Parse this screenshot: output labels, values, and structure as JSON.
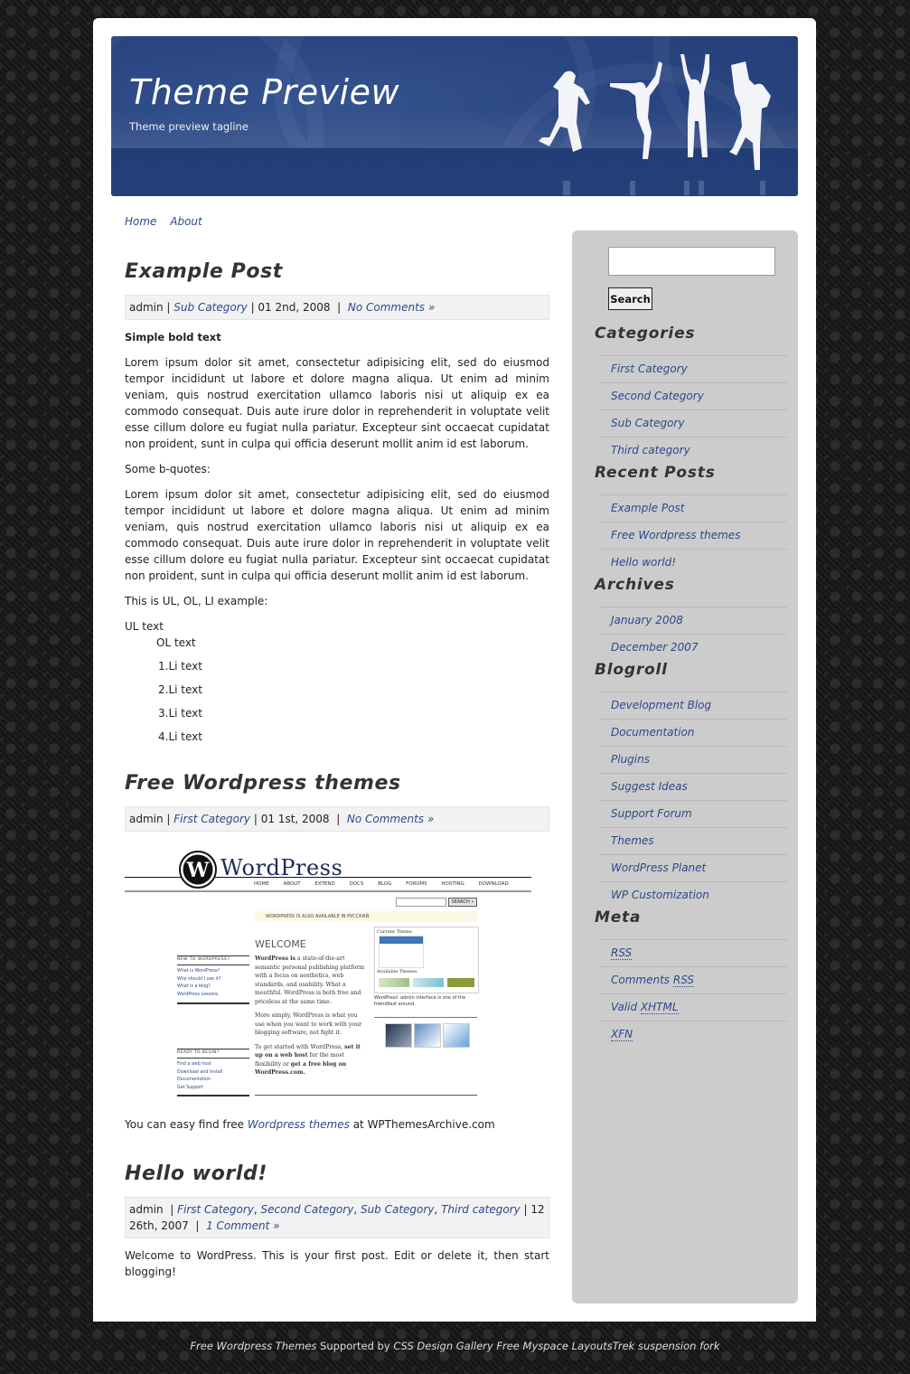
{
  "header": {
    "title": "Theme Preview",
    "tagline": "Theme preview tagline",
    "colors": {
      "banner": "#2a4682",
      "link": "#2b4a8a",
      "sidebar": "#cccccc"
    }
  },
  "nav": {
    "items": [
      {
        "label": "Home"
      },
      {
        "label": "About"
      }
    ]
  },
  "posts": [
    {
      "title": "Example Post",
      "meta": {
        "author": "admin",
        "categories": [
          "Sub Category"
        ],
        "date": "01 2nd, 2008",
        "comments": "No Comments »"
      },
      "bold_text": "Simple bold text",
      "paragraph1": "Lorem ipsum dolor sit amet, consectetur adipisicing elit, sed do eiusmod tempor incididunt ut labore et dolore magna aliqua. Ut enim ad minim veniam, quis nostrud exercitation ullamco laboris nisi ut aliquip ex ea commodo consequat. Duis aute irure dolor in reprehenderit in voluptate velit esse cillum dolore eu fugiat nulla pariatur. Excepteur sint occaecat cupidatat non proident, sunt in culpa qui officia deserunt mollit anim id est laborum.",
      "bquote_label": "Some b-quotes:",
      "paragraph2": "Lorem ipsum dolor sit amet, consectetur adipisicing elit, sed do eiusmod tempor incididunt ut labore et dolore magna aliqua. Ut enim ad minim veniam, quis nostrud exercitation ullamco laboris nisi ut aliquip ex ea commodo consequat. Duis aute irure dolor in reprehenderit in voluptate velit esse cillum dolore eu fugiat nulla pariatur. Excepteur sint occaecat cupidatat non proident, sunt in culpa qui officia deserunt mollit anim id est laborum.",
      "list_intro": "This is UL, OL, LI example:",
      "ul_text": "UL text",
      "ol_text": "OL text",
      "li_items": [
        "1.Li text",
        "2.Li text",
        "3.Li text",
        "4.Li text"
      ]
    },
    {
      "title": "Free Wordpress themes",
      "meta": {
        "author": "admin",
        "categories": [
          "First Category"
        ],
        "date": "01 1st, 2008",
        "comments": "No Comments »"
      },
      "screenshot": {
        "logo": "WordPress",
        "nav": [
          "HOME",
          "ABOUT",
          "EXTEND",
          "DOCS",
          "BLOG",
          "FORUMS",
          "HOSTING",
          "DOWNLOAD"
        ],
        "search_button": "SEARCH »",
        "notice": "WORDPRESS IS ALSO AVAILABLE IN РУССКИЙ.",
        "welcome": "WELCOME",
        "intro_bold": "WordPress is",
        "intro": "a state-of-the-art semantic personal publishing platform with a focus on aesthetics, web standards, and usability. What a mouthful. WordPress is both free and priceless at the same time.",
        "more": "More simply, WordPress is what you use when you want to work with your blogging software, not fight it.",
        "started_pre": "To get started with WordPress,",
        "started_link1": "set it up on a web host",
        "started_mid": "for the most flexibility or",
        "started_link2": "get a free blog on WordPress.com.",
        "new_heading": "NEW TO WORDPRESS?",
        "new_links": [
          "What is WordPress?",
          "Why should I use it?",
          "What is a blog?",
          "WordPress Lessons"
        ],
        "ready_heading": "READY TO BEGIN?",
        "ready_links": [
          "Find a web host",
          "Download and Install",
          "Documentation",
          "Get Support"
        ],
        "current_theme": "Current Theme",
        "available_themes": "Available Themes",
        "admin_caption": "WordPress' admin interface is one of the friendliest around."
      },
      "body_pre": "You can easy find free ",
      "body_link": "Wordpress themes",
      "body_post": " at WPThemesArchive.com"
    },
    {
      "title": "Hello world!",
      "meta": {
        "author": "admin",
        "categories": [
          "First Category",
          "Second Category",
          "Sub Category",
          "Third category"
        ],
        "date": "12 26th, 2007",
        "comments": "1 Comment »"
      },
      "body": "Welcome to WordPress. This is your first post. Edit or delete it, then start blogging!"
    }
  ],
  "sidebar": {
    "search": {
      "value": "",
      "button": "Search"
    },
    "categories": {
      "title": "Categories",
      "items": [
        "First Category",
        "Second Category",
        "Sub Category",
        "Third category"
      ]
    },
    "recent": {
      "title": "Recent Posts",
      "items": [
        "Example Post",
        "Free Wordpress themes",
        "Hello world!"
      ]
    },
    "archives": {
      "title": "Archives",
      "items": [
        "January 2008",
        "December 2007"
      ]
    },
    "blogroll": {
      "title": "Blogroll",
      "items": [
        "Development Blog",
        "Documentation",
        "Plugins",
        "Suggest Ideas",
        "Support Forum",
        "Themes",
        "WordPress Planet",
        "WP Customization"
      ]
    },
    "meta": {
      "title": "Meta",
      "rss": "RSS",
      "comments_pre": "Comments ",
      "comments_abbr": "RSS",
      "valid_pre": "Valid ",
      "valid_abbr": "XHTML",
      "xfn": "XFN"
    }
  },
  "footer": {
    "link1": "Free Wordpress Themes",
    "text1": " Supported by ",
    "link2": "CSS Design Gallery",
    "link3": "Free Myspace Layouts",
    "link4": "Trek suspension fork"
  }
}
